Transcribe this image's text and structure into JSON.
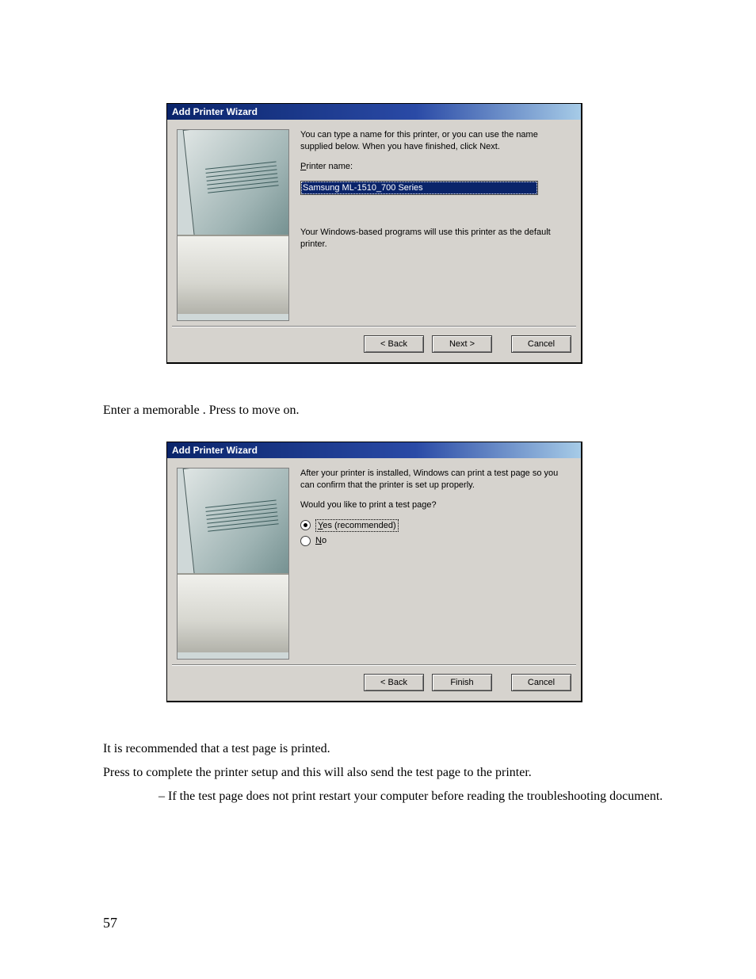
{
  "dialog1": {
    "title": "Add Printer Wizard",
    "intro": "You can type a name for this printer, or you can use the name supplied below. When you have finished, click Next.",
    "printerNameLabelPrefix": "P",
    "printerNameLabelRest": "rinter name:",
    "printerNameValue": "Samsung ML-1510_700 Series",
    "defaultNote": "Your Windows-based programs will use this printer as the default printer.",
    "buttons": {
      "back": "< Back",
      "next": "Next >",
      "cancel": "Cancel"
    }
  },
  "caption1": {
    "part1": "Enter a memorable ",
    "part2": ".  Press ",
    "part3": " to move on."
  },
  "dialog2": {
    "title": "Add Printer Wizard",
    "intro": "After your printer is installed, Windows can print a test page so you can confirm that the printer is set up properly.",
    "question": "Would you like to print a test page?",
    "yesPrefix": "Y",
    "yesRest": "es (recommended)",
    "noPrefix": "N",
    "noRest": "o",
    "buttons": {
      "back": "< Back",
      "finish": "Finish",
      "cancel": "Cancel"
    }
  },
  "caption2": "It is recommended that a test page is printed.",
  "caption3": {
    "part1": "Press ",
    "part2": " to complete the printer setup and this will also send the test page to the printer."
  },
  "caption4": {
    "dash": "– ",
    "text": "If the test page does not print restart your computer before reading the troubleshooting document."
  },
  "pageNumber": "57"
}
